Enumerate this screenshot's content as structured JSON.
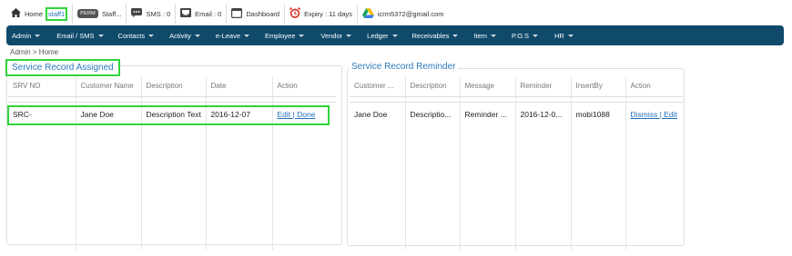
{
  "topbar": {
    "home_label": "Home",
    "staff_link": "staff1",
    "perm_badge": "PERM",
    "staff_label": "Staff...",
    "sms_label": "SMS : 0",
    "email_label": "Email : 0",
    "dashboard_label": "Dashboard",
    "expiry_label": "Expiry : 11 days",
    "account_email": "icrm5372@gmail.com"
  },
  "nav": [
    {
      "label": "Admin"
    },
    {
      "label": "Email / SMS"
    },
    {
      "label": "Contacts"
    },
    {
      "label": "Activity"
    },
    {
      "label": "e-Leave"
    },
    {
      "label": "Employee"
    },
    {
      "label": "Vendor"
    },
    {
      "label": "Ledger"
    },
    {
      "label": "Receivables"
    },
    {
      "label": "Item"
    },
    {
      "label": "P.O.S"
    },
    {
      "label": "HR"
    }
  ],
  "breadcrumb": "Admin > Home",
  "assigned": {
    "title": "Service Record Assigned",
    "columns": [
      "SRV NO",
      "Customer Name",
      "Description",
      "Date",
      "Action"
    ],
    "row": {
      "srv_no": "SRC-",
      "customer": "Jane Doe",
      "description": "Description Text",
      "date": "2016-12-07",
      "action": "Edit | Done"
    }
  },
  "reminder": {
    "title": "Service Record Reminder",
    "columns": [
      "Customer ...",
      "Description",
      "Message",
      "Reminder",
      "InsertBy",
      "Action"
    ],
    "row": {
      "customer": "Jane Doe",
      "description": "Descriptio...",
      "message": "Reminder ...",
      "reminder": "2016-12-0...",
      "insert_by": "mobi1088",
      "action": "Dismiss | Edit"
    }
  },
  "colors": {
    "nav_bg": "#0f4a6b",
    "title_blue": "#2b7bbd",
    "highlight_green": "#2fd63c",
    "expiry_red": "#e02b20"
  }
}
